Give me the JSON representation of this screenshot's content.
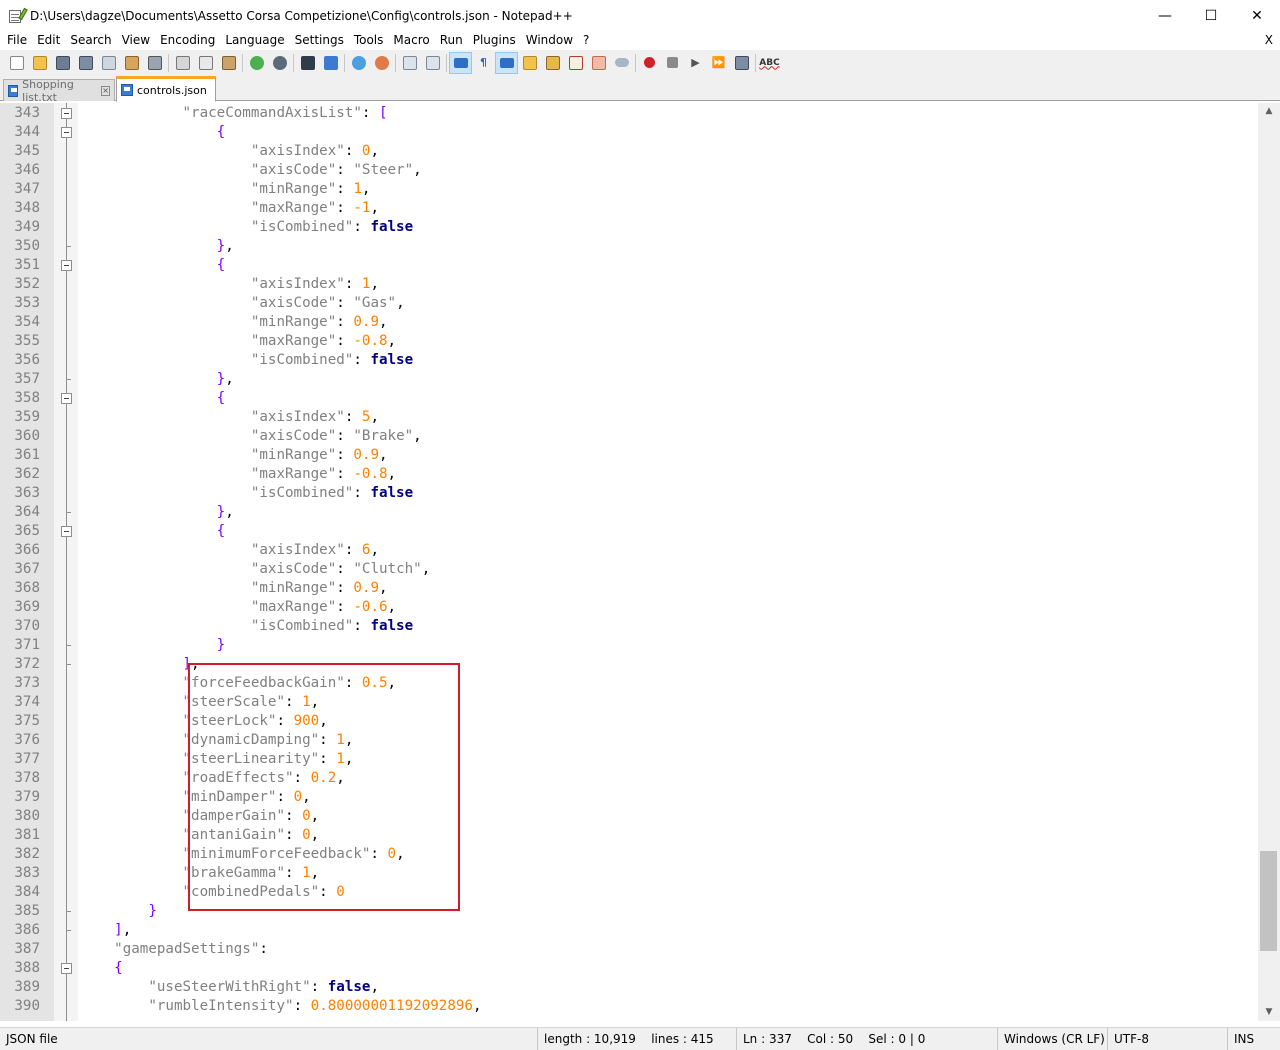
{
  "window": {
    "title": "D:\\Users\\dagze\\Documents\\Assetto Corsa Competizione\\Config\\controls.json - Notepad++",
    "min_glyph": "—",
    "max_glyph": "☐",
    "close_glyph": "✕"
  },
  "menu": {
    "items": [
      "File",
      "Edit",
      "Search",
      "View",
      "Encoding",
      "Language",
      "Settings",
      "Tools",
      "Macro",
      "Run",
      "Plugins",
      "Window",
      "?"
    ],
    "close_glyph": "X"
  },
  "toolbar": {
    "icons": [
      "new-file",
      "open-file",
      "save",
      "save-all",
      "close",
      "close-all",
      "print",
      "cut",
      "copy",
      "paste",
      "undo",
      "redo",
      "find",
      "replace",
      "zoom-in",
      "zoom-out",
      "sync-vertical",
      "sync-horizontal",
      "word-wrap",
      "show-all-chars",
      "indent-guide",
      "define-language",
      "document-map",
      "function-list",
      "folder-as-workspace",
      "monitoring",
      "record-macro",
      "stop-recording",
      "playback",
      "run-macro-multiple",
      "save-macro",
      "spell-check"
    ],
    "spellcheck_label": "ABC"
  },
  "tabs": [
    {
      "label": "Shopping list.txt",
      "active": false
    },
    {
      "label": "controls.json",
      "active": true
    }
  ],
  "editor": {
    "lines": [
      {
        "n": "343",
        "fold": "open",
        "html": "            <span class=\"s\">\"raceCommandAxisList\"</span>: <span class=\"p\">[</span>"
      },
      {
        "n": "344",
        "fold": "open",
        "html": "                <span class=\"p\">{</span>"
      },
      {
        "n": "345",
        "fold": "",
        "html": "                    <span class=\"s\">\"axisIndex\"</span>: <span class=\"n\">0</span>,"
      },
      {
        "n": "346",
        "fold": "",
        "html": "                    <span class=\"s\">\"axisCode\"</span>: <span class=\"s\">\"Steer\"</span>,"
      },
      {
        "n": "347",
        "fold": "",
        "html": "                    <span class=\"s\">\"minRange\"</span>: <span class=\"n\">1</span>,"
      },
      {
        "n": "348",
        "fold": "",
        "html": "                    <span class=\"s\">\"maxRange\"</span>: <span class=\"n\">-1</span>,"
      },
      {
        "n": "349",
        "fold": "",
        "html": "                    <span class=\"s\">\"isCombined\"</span>: <span class=\"b\">false</span>"
      },
      {
        "n": "350",
        "fold": "end",
        "html": "                <span class=\"p\">}</span>,"
      },
      {
        "n": "351",
        "fold": "open",
        "html": "                <span class=\"p\">{</span>"
      },
      {
        "n": "352",
        "fold": "",
        "html": "                    <span class=\"s\">\"axisIndex\"</span>: <span class=\"n\">1</span>,"
      },
      {
        "n": "353",
        "fold": "",
        "html": "                    <span class=\"s\">\"axisCode\"</span>: <span class=\"s\">\"Gas\"</span>,"
      },
      {
        "n": "354",
        "fold": "",
        "html": "                    <span class=\"s\">\"minRange\"</span>: <span class=\"n\">0.9</span>,"
      },
      {
        "n": "355",
        "fold": "",
        "html": "                    <span class=\"s\">\"maxRange\"</span>: <span class=\"n\">-0.8</span>,"
      },
      {
        "n": "356",
        "fold": "",
        "html": "                    <span class=\"s\">\"isCombined\"</span>: <span class=\"b\">false</span>"
      },
      {
        "n": "357",
        "fold": "end",
        "html": "                <span class=\"p\">}</span>,"
      },
      {
        "n": "358",
        "fold": "open",
        "html": "                <span class=\"p\">{</span>"
      },
      {
        "n": "359",
        "fold": "",
        "html": "                    <span class=\"s\">\"axisIndex\"</span>: <span class=\"n\">5</span>,"
      },
      {
        "n": "360",
        "fold": "",
        "html": "                    <span class=\"s\">\"axisCode\"</span>: <span class=\"s\">\"Brake\"</span>,"
      },
      {
        "n": "361",
        "fold": "",
        "html": "                    <span class=\"s\">\"minRange\"</span>: <span class=\"n\">0.9</span>,"
      },
      {
        "n": "362",
        "fold": "",
        "html": "                    <span class=\"s\">\"maxRange\"</span>: <span class=\"n\">-0.8</span>,"
      },
      {
        "n": "363",
        "fold": "",
        "html": "                    <span class=\"s\">\"isCombined\"</span>: <span class=\"b\">false</span>"
      },
      {
        "n": "364",
        "fold": "end",
        "html": "                <span class=\"p\">}</span>,"
      },
      {
        "n": "365",
        "fold": "open",
        "html": "                <span class=\"p\">{</span>"
      },
      {
        "n": "366",
        "fold": "",
        "html": "                    <span class=\"s\">\"axisIndex\"</span>: <span class=\"n\">6</span>,"
      },
      {
        "n": "367",
        "fold": "",
        "html": "                    <span class=\"s\">\"axisCode\"</span>: <span class=\"s\">\"Clutch\"</span>,"
      },
      {
        "n": "368",
        "fold": "",
        "html": "                    <span class=\"s\">\"minRange\"</span>: <span class=\"n\">0.9</span>,"
      },
      {
        "n": "369",
        "fold": "",
        "html": "                    <span class=\"s\">\"maxRange\"</span>: <span class=\"n\">-0.6</span>,"
      },
      {
        "n": "370",
        "fold": "",
        "html": "                    <span class=\"s\">\"isCombined\"</span>: <span class=\"b\">false</span>"
      },
      {
        "n": "371",
        "fold": "end",
        "html": "                <span class=\"p\">}</span>"
      },
      {
        "n": "372",
        "fold": "end",
        "html": "            <span class=\"p\">]</span>,"
      },
      {
        "n": "373",
        "fold": "",
        "html": "            <span class=\"s\">\"forceFeedbackGain\"</span>: <span class=\"n\">0.5</span>,"
      },
      {
        "n": "374",
        "fold": "",
        "html": "            <span class=\"s\">\"steerScale\"</span>: <span class=\"n\">1</span>,"
      },
      {
        "n": "375",
        "fold": "",
        "html": "            <span class=\"s\">\"steerLock\"</span>: <span class=\"n\">900</span>,"
      },
      {
        "n": "376",
        "fold": "",
        "html": "            <span class=\"s\">\"dynamicDamping\"</span>: <span class=\"n\">1</span>,"
      },
      {
        "n": "377",
        "fold": "",
        "html": "            <span class=\"s\">\"steerLinearity\"</span>: <span class=\"n\">1</span>,"
      },
      {
        "n": "378",
        "fold": "",
        "html": "            <span class=\"s\">\"roadEffects\"</span>: <span class=\"n\">0.2</span>,"
      },
      {
        "n": "379",
        "fold": "",
        "html": "            <span class=\"s\">\"minDamper\"</span>: <span class=\"n\">0</span>,"
      },
      {
        "n": "380",
        "fold": "",
        "html": "            <span class=\"s\">\"damperGain\"</span>: <span class=\"n\">0</span>,"
      },
      {
        "n": "381",
        "fold": "",
        "html": "            <span class=\"s\">\"antaniGain\"</span>: <span class=\"n\">0</span>,"
      },
      {
        "n": "382",
        "fold": "",
        "html": "            <span class=\"s\">\"minimumForceFeedback\"</span>: <span class=\"n\">0</span>,"
      },
      {
        "n": "383",
        "fold": "",
        "html": "            <span class=\"s\">\"brakeGamma\"</span>: <span class=\"n\">1</span>,"
      },
      {
        "n": "384",
        "fold": "",
        "html": "            <span class=\"s\">\"combinedPedals\"</span>: <span class=\"n\">0</span>"
      },
      {
        "n": "385",
        "fold": "end",
        "html": "        <span class=\"p\">}</span>"
      },
      {
        "n": "386",
        "fold": "end",
        "html": "    <span class=\"p\">]</span>,"
      },
      {
        "n": "387",
        "fold": "",
        "html": "    <span class=\"s\">\"gamepadSettings\"</span>:"
      },
      {
        "n": "388",
        "fold": "open",
        "html": "    <span class=\"p\">{</span>"
      },
      {
        "n": "389",
        "fold": "",
        "html": "        <span class=\"s\">\"useSteerWithRight\"</span>: <span class=\"b\">false</span>,"
      },
      {
        "n": "390",
        "fold": "",
        "html": "        <span class=\"s\">\"rumbleIntensity\"</span>: <span class=\"n\">0.800000011920928 96</span>,"
      }
    ]
  },
  "status": {
    "file_type": "JSON file",
    "length": "length : 10,919",
    "lines": "lines : 415",
    "ln": "Ln : 337",
    "col": "Col : 50",
    "sel": "Sel : 0 | 0",
    "eol": "Windows (CR LF)",
    "encoding": "UTF-8",
    "mode": "INS"
  }
}
